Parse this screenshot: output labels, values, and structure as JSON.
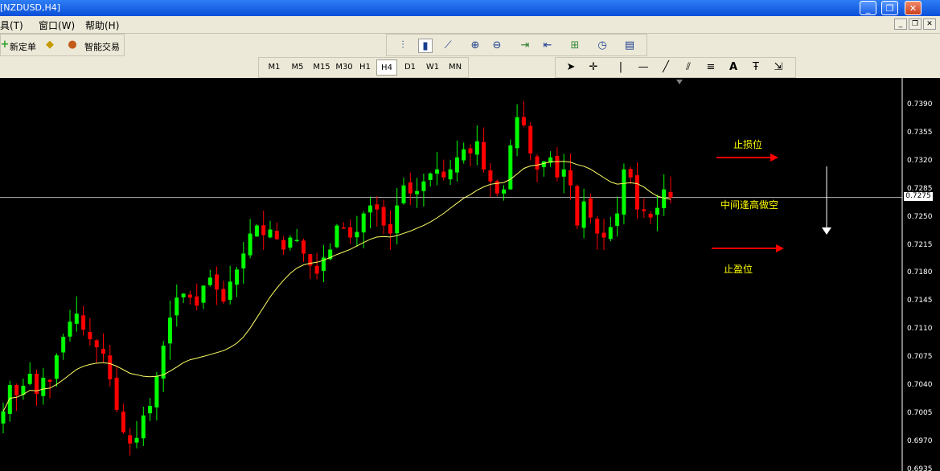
{
  "window": {
    "title": "[NZDUSD,H4]",
    "minimize_glyph": "_",
    "restore_glyph": "❐",
    "close_glyph": "✕"
  },
  "menu": {
    "items": [
      {
        "label": "具(T)"
      },
      {
        "label": "窗口(W)"
      },
      {
        "label": "帮助(H)"
      }
    ]
  },
  "mdi": {
    "minimize_glyph": "_",
    "restore_glyph": "❐",
    "close_glyph": "✕"
  },
  "toolbar": {
    "new_order_label": "新定单",
    "autotrade_label": "智能交易",
    "icons": [
      "bar-chart-icon",
      "candlestick-icon",
      "line-chart-icon",
      "zoom-in-icon",
      "zoom-out-icon",
      "chart-shift-icon",
      "autoscroll-icon",
      "indicators-icon",
      "periods-icon",
      "templates-icon"
    ]
  },
  "timeframes": [
    "M1",
    "M5",
    "M15",
    "M30",
    "H1",
    "H4",
    "D1",
    "W1",
    "MN"
  ],
  "active_timeframe": "H4",
  "drawing_tools": {
    "text_tool_label": "A",
    "icons": [
      "cursor-icon",
      "crosshair-icon",
      "vertical-line-icon",
      "horizontal-line-icon",
      "trendline-icon",
      "equidistant-channel-icon",
      "fibonacci-icon",
      "text-icon",
      "text-label-icon",
      "arrows-icon"
    ]
  },
  "chart": {
    "symbol": "NZDUSD",
    "timeframe": "H4",
    "bull_color": "#00ff00",
    "bear_color": "#ff0000",
    "ma_color": "#ffff66",
    "price_ticks": [
      "0.7390",
      "0.7355",
      "0.7320",
      "0.7285",
      "0.7250",
      "0.7215",
      "0.7180",
      "0.7145",
      "0.7110",
      "0.7075",
      "0.7040",
      "0.7005",
      "0.6970",
      "0.6935"
    ],
    "current_price": "0.7275",
    "annotations": {
      "stop_loss": "止损位",
      "middle": "中间逢高做空",
      "take_profit": "止盈位"
    },
    "annotation_color": "#ffff00",
    "arrow_color": "#ff0000",
    "down_arrow_color": "#ffffff"
  },
  "chart_data": {
    "type": "candlestick",
    "ylim": [
      0.6935,
      0.7405
    ],
    "series": [
      {
        "closes": [
          0.7008,
          0.7041,
          0.7028,
          0.704,
          0.7055,
          0.703,
          0.705,
          0.7045,
          0.7078,
          0.7101,
          0.712,
          0.713,
          0.711,
          0.7098,
          0.7088,
          0.708,
          0.7048,
          0.701,
          0.6982,
          0.6968,
          0.6975,
          0.7003,
          0.7015,
          0.7052,
          0.709,
          0.7125,
          0.715,
          0.7155,
          0.715,
          0.714,
          0.7165,
          0.7175,
          0.716,
          0.7145,
          0.717,
          0.7185,
          0.7205,
          0.723,
          0.724,
          0.7228,
          0.7235,
          0.7223,
          0.721,
          0.7225,
          0.7222,
          0.7205,
          0.719,
          0.718,
          0.72,
          0.721,
          0.724,
          0.7237,
          0.7225,
          0.7232,
          0.7255,
          0.7265,
          0.726,
          0.724,
          0.723,
          0.7265,
          0.729,
          0.728,
          0.7283,
          0.7295,
          0.7305,
          0.731,
          0.73,
          0.731,
          0.7325,
          0.7335,
          0.733,
          0.7345,
          0.731,
          0.7295,
          0.728,
          0.7285,
          0.734,
          0.7375,
          0.7365,
          0.733,
          0.731,
          0.732,
          0.7325,
          0.73,
          0.731,
          0.729,
          0.724,
          0.727,
          0.725,
          0.723,
          0.7225,
          0.7238,
          0.7255,
          0.731,
          0.73,
          0.726,
          0.7258,
          0.725,
          0.7262,
          0.7285,
          0.7275
        ]
      }
    ]
  }
}
